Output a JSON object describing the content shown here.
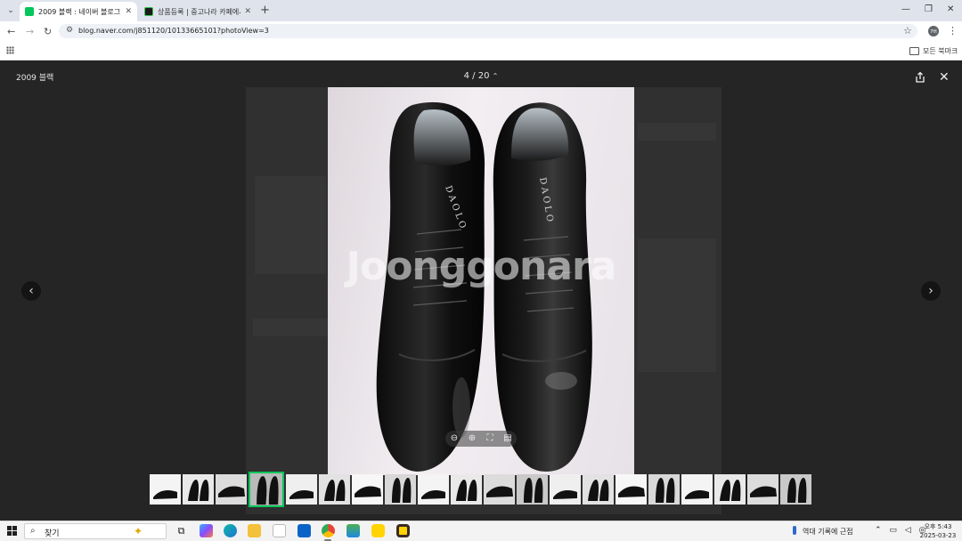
{
  "browser": {
    "tabs": [
      {
        "title": "2009 블랙 : 네이버 블로그",
        "active": true,
        "favicon_color": "#03c75a"
      },
      {
        "title": "상품등록 | 중고나라 카페에서",
        "active": false,
        "favicon_color": "#1a1a1a"
      }
    ],
    "url": "blog.naver.com/j851120/10133665101?photoView=3",
    "profile_initials": "7버",
    "bookmarks_folder": "모든 북마크"
  },
  "viewer": {
    "title": "2009 블랙",
    "counter": "4 / 20",
    "watermark": "Joonggonara",
    "selected_thumbnail_index": 3,
    "thumbnail_count": 20,
    "accent_color": "#03c75a"
  },
  "taskbar": {
    "search_placeholder": "찾기",
    "weather_text": "역대 기록에 근접",
    "time": "오후 5:43",
    "date": "2025-03-23"
  }
}
